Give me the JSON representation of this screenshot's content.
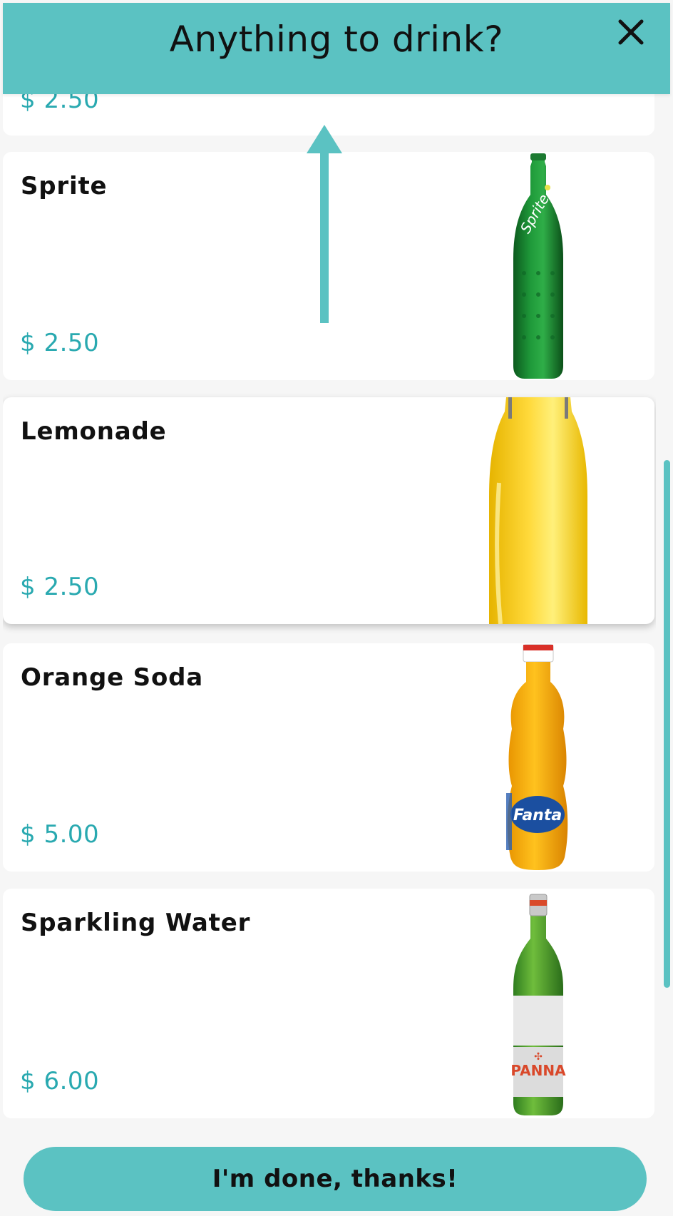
{
  "header": {
    "title": "Anything to drink?",
    "close_icon": "close-icon"
  },
  "products": [
    {
      "name": "",
      "price": "$ 2.50",
      "icon": "cut-off-item",
      "partial": true
    },
    {
      "name": "Sprite",
      "price": "$ 2.50",
      "icon": "green-bottle-icon"
    },
    {
      "name": "Lemonade",
      "price": "$ 2.50",
      "icon": "lemonade-bottle-icon"
    },
    {
      "name": "Orange Soda",
      "price": "$ 5.00",
      "icon": "orange-soda-bottle-icon"
    },
    {
      "name": "Sparkling Water",
      "price": "$ 6.00",
      "icon": "sparkling-water-bottle-icon"
    }
  ],
  "scroll_hint_icon": "up-arrow-icon",
  "done_button": "I'm done, thanks!",
  "colors": {
    "accent": "#5bc2c2",
    "price": "#29a9b0",
    "background": "#f6f6f6"
  }
}
